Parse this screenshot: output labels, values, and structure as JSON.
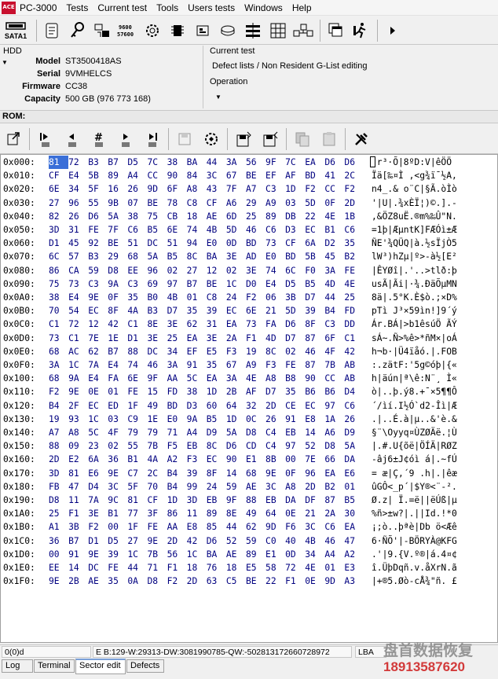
{
  "app": {
    "title": "PC-3000",
    "logo_text": "ACE"
  },
  "menu": [
    "Tests",
    "Current test",
    "Tools",
    "Users tests",
    "Windows",
    "Help"
  ],
  "toolbar": {
    "sata_label": "SATA1"
  },
  "hdd": {
    "caption": "HDD",
    "fields": [
      {
        "label": "Model",
        "value": "ST3500418AS"
      },
      {
        "label": "Serial",
        "value": "9VMHELCS"
      },
      {
        "label": "Firmware",
        "value": "CC38"
      },
      {
        "label": "Capacity",
        "value": "500 GB (976 773 168)"
      }
    ]
  },
  "current_test": {
    "caption": "Current test",
    "value": "Defect lists / Non Resident G-List editing"
  },
  "operation": {
    "caption": "Operation",
    "value": ""
  },
  "rom": {
    "label": "ROM:"
  },
  "hex": {
    "cursor_offset": "0x000",
    "rows": [
      {
        "offset": "0x000:",
        "bytes": [
          "81",
          "72",
          "B3",
          "B7",
          "D5",
          "7C",
          "38",
          "BA",
          "44",
          "3A",
          "56",
          "9F",
          "7C",
          "EA",
          "D6",
          "D6"
        ],
        "ascii": " r³·Õ|8ºD:V|êÖÖ"
      },
      {
        "offset": "0x010:",
        "bytes": [
          "CF",
          "E4",
          "5B",
          "89",
          "A4",
          "CC",
          "90",
          "84",
          "3C",
          "67",
          "BE",
          "EF",
          "AF",
          "BD",
          "41",
          "2C"
        ],
        "ascii": "Ïä[‰¤Ì ‚<g¾ï¯½A,"
      },
      {
        "offset": "0x020:",
        "bytes": [
          "6E",
          "34",
          "5F",
          "16",
          "26",
          "9D",
          "6F",
          "A8",
          "43",
          "7F",
          "A7",
          "C3",
          "1D",
          "F2",
          "CC",
          "F2"
        ],
        "ascii": "n4_.& o¨C|§Ã.òÌò"
      },
      {
        "offset": "0x030:",
        "bytes": [
          "27",
          "96",
          "55",
          "9B",
          "07",
          "BE",
          "78",
          "C8",
          "CF",
          "A6",
          "29",
          "A9",
          "03",
          "5D",
          "0F",
          "2D"
        ],
        "ascii": "'|U|.¾xÈÏ¦)©.].-"
      },
      {
        "offset": "0x040:",
        "bytes": [
          "82",
          "26",
          "D6",
          "5A",
          "38",
          "75",
          "CB",
          "18",
          "AE",
          "6D",
          "25",
          "89",
          "DB",
          "22",
          "4E",
          "1B"
        ],
        "ascii": "‚&ÖZ8uË.®m%‰Û\"N."
      },
      {
        "offset": "0x050:",
        "bytes": [
          "3D",
          "31",
          "FE",
          "7F",
          "C6",
          "B5",
          "6E",
          "74",
          "4B",
          "5D",
          "46",
          "C6",
          "D3",
          "EC",
          "B1",
          "C6"
        ],
        "ascii": "=1þ|ÆµntK]FÆÓì±Æ"
      },
      {
        "offset": "0x060:",
        "bytes": [
          "D1",
          "45",
          "92",
          "BE",
          "51",
          "DC",
          "51",
          "94",
          "E0",
          "0D",
          "BD",
          "73",
          "CF",
          "6A",
          "D2",
          "35"
        ],
        "ascii": "ÑE'¾QÜQ|à.½sÏjÒ5"
      },
      {
        "offset": "0x070:",
        "bytes": [
          "6C",
          "57",
          "B3",
          "29",
          "68",
          "5A",
          "B5",
          "8C",
          "BA",
          "3E",
          "AD",
          "E0",
          "BD",
          "5B",
          "45",
          "B2"
        ],
        "ascii": "lW³)hZµ|º>-à½[E²"
      },
      {
        "offset": "0x080:",
        "bytes": [
          "86",
          "CA",
          "59",
          "D8",
          "EE",
          "96",
          "02",
          "27",
          "12",
          "02",
          "3E",
          "74",
          "6C",
          "F0",
          "3A",
          "FE"
        ],
        "ascii": "|ÊYØî|.'..>tlð:þ"
      },
      {
        "offset": "0x090:",
        "bytes": [
          "75",
          "73",
          "C3",
          "9A",
          "C3",
          "69",
          "97",
          "B7",
          "BE",
          "1C",
          "D0",
          "E4",
          "D5",
          "B5",
          "4D",
          "4E"
        ],
        "ascii": "usÃ|Ãi|·¾.ÐäÕµMN"
      },
      {
        "offset": "0x0A0:",
        "bytes": [
          "38",
          "E4",
          "9E",
          "0F",
          "35",
          "B0",
          "4B",
          "01",
          "C8",
          "24",
          "F2",
          "06",
          "3B",
          "D7",
          "44",
          "25"
        ],
        "ascii": "8ä|.5°K.È$ò.;×D%"
      },
      {
        "offset": "0x0B0:",
        "bytes": [
          "70",
          "54",
          "EC",
          "8F",
          "4A",
          "B3",
          "D7",
          "35",
          "39",
          "EC",
          "6E",
          "21",
          "5D",
          "39",
          "B4",
          "FD"
        ],
        "ascii": "pTì J³×59ìn!]9´ý"
      },
      {
        "offset": "0x0C0:",
        "bytes": [
          "C1",
          "72",
          "12",
          "42",
          "C1",
          "8E",
          "3E",
          "62",
          "31",
          "EA",
          "73",
          "FA",
          "D6",
          "8F",
          "C3",
          "DD"
        ],
        "ascii": "Ár.BÁ|>b1êsúÖ ÃÝ"
      },
      {
        "offset": "0x0D0:",
        "bytes": [
          "73",
          "C1",
          "7E",
          "1E",
          "D1",
          "3E",
          "25",
          "EA",
          "3E",
          "2A",
          "F1",
          "4D",
          "D7",
          "87",
          "6F",
          "C1"
        ],
        "ascii": "sÁ~.Ñ>%ê>*ñM×|oÁ"
      },
      {
        "offset": "0x0E0:",
        "bytes": [
          "68",
          "AC",
          "62",
          "B7",
          "88",
          "DC",
          "34",
          "EF",
          "E5",
          "F3",
          "19",
          "8C",
          "02",
          "46",
          "4F",
          "42"
        ],
        "ascii": "h¬b·|Ü4ïåó.|.FOB"
      },
      {
        "offset": "0x0F0:",
        "bytes": [
          "3A",
          "1C",
          "7A",
          "E4",
          "74",
          "46",
          "3A",
          "91",
          "35",
          "67",
          "A9",
          "F3",
          "FE",
          "87",
          "7B",
          "AB"
        ],
        "ascii": ":.zätF:'5g©óþ|{«"
      },
      {
        "offset": "0x100:",
        "bytes": [
          "68",
          "9A",
          "E4",
          "FA",
          "6E",
          "9F",
          "AA",
          "5C",
          "EA",
          "3A",
          "4E",
          "A8",
          "B8",
          "90",
          "CC",
          "AB"
        ],
        "ascii": "h|äún|ª\\ê:N¨¸ Ì«"
      },
      {
        "offset": "0x110:",
        "bytes": [
          "F2",
          "9E",
          "0E",
          "01",
          "FE",
          "15",
          "FD",
          "38",
          "1D",
          "2B",
          "AF",
          "D7",
          "35",
          "B6",
          "B6",
          "D4"
        ],
        "ascii": "ò|..þ.ý8.+¯×5¶¶Ô"
      },
      {
        "offset": "0x120:",
        "bytes": [
          "B4",
          "2F",
          "EC",
          "ED",
          "1F",
          "49",
          "BD",
          "D3",
          "60",
          "64",
          "32",
          "2D",
          "CE",
          "EC",
          "97",
          "C6"
        ],
        "ascii": "´/ìí.I½Ó`d2-Îì|Æ"
      },
      {
        "offset": "0x130:",
        "bytes": [
          "19",
          "93",
          "1C",
          "03",
          "C9",
          "1E",
          "E0",
          "9A",
          "B5",
          "1D",
          "0C",
          "26",
          "91",
          "E8",
          "1A",
          "26"
        ],
        "ascii": ".|..É.à|µ..&'è.&"
      },
      {
        "offset": "0x140:",
        "bytes": [
          "A7",
          "A8",
          "5C",
          "4F",
          "79",
          "79",
          "71",
          "A4",
          "D9",
          "5A",
          "D8",
          "C4",
          "EB",
          "14",
          "A6",
          "D9"
        ],
        "ascii": "§¨\\Oyyq¤ÙZØÄë.¦Ù"
      },
      {
        "offset": "0x150:",
        "bytes": [
          "88",
          "09",
          "23",
          "02",
          "55",
          "7B",
          "F5",
          "EB",
          "8C",
          "D6",
          "CD",
          "C4",
          "97",
          "52",
          "D8",
          "5A"
        ],
        "ascii": "|.#.U{õë|ÖÍÄ|RØZ"
      },
      {
        "offset": "0x160:",
        "bytes": [
          "2D",
          "E2",
          "6A",
          "36",
          "B1",
          "4A",
          "A2",
          "F3",
          "EC",
          "90",
          "E1",
          "8B",
          "00",
          "7E",
          "66",
          "DA"
        ],
        "ascii": "-âj6±J¢óì á|.~fÚ"
      },
      {
        "offset": "0x170:",
        "bytes": [
          "3D",
          "81",
          "E6",
          "9E",
          "C7",
          "2C",
          "B4",
          "39",
          "8F",
          "14",
          "68",
          "9E",
          "0F",
          "96",
          "EA",
          "E6"
        ],
        "ascii": "= æ|Ç,´9 .h|.|êæ"
      },
      {
        "offset": "0x180:",
        "bytes": [
          "FB",
          "47",
          "D4",
          "3C",
          "5F",
          "70",
          "B4",
          "99",
          "24",
          "59",
          "AE",
          "3C",
          "A8",
          "2D",
          "B2",
          "01"
        ],
        "ascii": "ûGÔ<_p´|$Y®<¨-².",
        "note": ""
      },
      {
        "offset": "0x190:",
        "bytes": [
          "D8",
          "11",
          "7A",
          "9C",
          "81",
          "CF",
          "1D",
          "3D",
          "EB",
          "9F",
          "88",
          "EB",
          "DA",
          "DF",
          "87",
          "B5"
        ],
        "ascii": "Ø.z| Ï.=ë||ëÚß|µ"
      },
      {
        "offset": "0x1A0:",
        "bytes": [
          "25",
          "F1",
          "3E",
          "B1",
          "77",
          "3F",
          "86",
          "11",
          "89",
          "8E",
          "49",
          "64",
          "0E",
          "21",
          "2A",
          "30"
        ],
        "ascii": "%ñ>±w?|.||Id.!*0"
      },
      {
        "offset": "0x1B0:",
        "bytes": [
          "A1",
          "3B",
          "F2",
          "00",
          "1F",
          "FE",
          "AA",
          "E8",
          "85",
          "44",
          "62",
          "9D",
          "F6",
          "3C",
          "C6",
          "EA"
        ],
        "ascii": "¡;ò..þªè|Db ö<Æê"
      },
      {
        "offset": "0x1C0:",
        "bytes": [
          "36",
          "B7",
          "D1",
          "D5",
          "27",
          "9E",
          "2D",
          "42",
          "D6",
          "52",
          "59",
          "C0",
          "40",
          "4B",
          "46",
          "47"
        ],
        "ascii": "6·ÑÕ'|-BÖRYÀ@KFG"
      },
      {
        "offset": "0x1D0:",
        "bytes": [
          "00",
          "91",
          "9E",
          "39",
          "1C",
          "7B",
          "56",
          "1C",
          "BA",
          "AE",
          "89",
          "E1",
          "0D",
          "34",
          "A4",
          "A2"
        ],
        "ascii": ".'|9.{V.º®|á.4¤¢"
      },
      {
        "offset": "0x1E0:",
        "bytes": [
          "EE",
          "14",
          "DC",
          "FE",
          "44",
          "71",
          "F1",
          "18",
          "76",
          "18",
          "E5",
          "58",
          "72",
          "4E",
          "01",
          "E3"
        ],
        "ascii": "î.ÜþDqñ.v.åXrN.ã"
      },
      {
        "offset": "0x1F0:",
        "bytes": [
          "9E",
          "2B",
          "AE",
          "35",
          "0A",
          "D8",
          "F2",
          "2D",
          "63",
          "C5",
          "BE",
          "22",
          "F1",
          "0E",
          "9D",
          "A3"
        ],
        "ascii": "|+®5.Øò-cÅ¾\"ñ. £"
      }
    ]
  },
  "status": {
    "position": "0(0)d",
    "info": "E B:129-W:29313-DW:3081990785-QW:-502813172660728972",
    "lba_label": "LBA"
  },
  "tabs": [
    "Log",
    "Terminal",
    "Sector edit",
    "Defects"
  ],
  "active_tab": "Sector edit",
  "watermark": {
    "title": "盘首数据恢复",
    "phone": "18913587620"
  },
  "colors": {
    "hex_bytes": "#000080",
    "cursor": "#3a6fd8",
    "watermark_phone": "#d23a3a"
  }
}
